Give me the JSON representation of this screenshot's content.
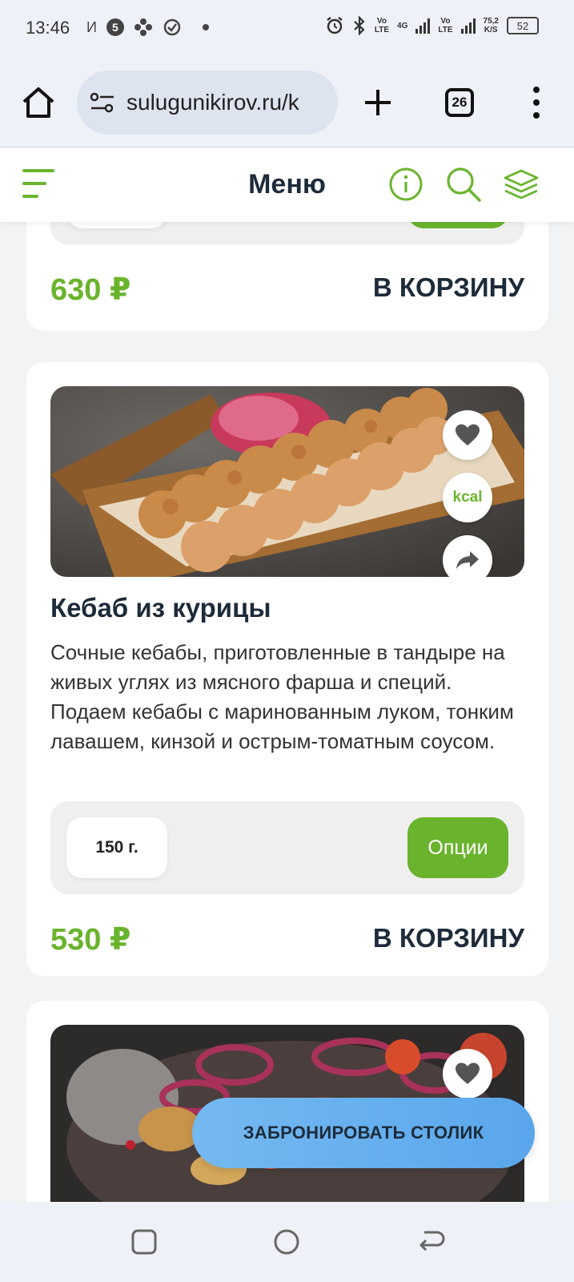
{
  "status_bar": {
    "time": "13:46",
    "carrier_mark": "И",
    "circle_badge": "5",
    "net_left": "Vo\nLTE",
    "net_4g": "4G",
    "net_right": "Vo\nLTE",
    "speed": "75,2\nK/S",
    "battery": "52"
  },
  "browser": {
    "url": "sulugunikirov.ru/k",
    "tab_count": "26"
  },
  "header": {
    "title": "Меню"
  },
  "products": [
    {
      "price": "630 ₽",
      "cart_label": "В КОРЗИНУ"
    },
    {
      "title": "Кебаб из курицы",
      "description": "Сочные кебабы, приготовленные в тандыре на живых углях из мясного фарша и специй. Подаем кебабы с маринованным луком, тонким лавашем, кинзой и острым-томатным соусом.",
      "weight": "150 г.",
      "options_label": "Опции",
      "price": "530 ₽",
      "cart_label": "В КОРЗИНУ",
      "kcal_label": "kcal"
    }
  ],
  "booking_button": "ЗАБРОНИРОВАТЬ СТОЛИК",
  "colors": {
    "accent_green": "#6ab42d",
    "dark_text": "#1d2b3a",
    "booking_blue": "#5aa6ec"
  },
  "icons": [
    "home-icon",
    "site-settings-icon",
    "plus-icon",
    "tabs-icon",
    "more-vert-icon",
    "menu-icon",
    "info-icon",
    "search-icon",
    "layers-icon",
    "heart-icon",
    "share-icon",
    "square-icon",
    "circle-icon",
    "back-icon"
  ]
}
